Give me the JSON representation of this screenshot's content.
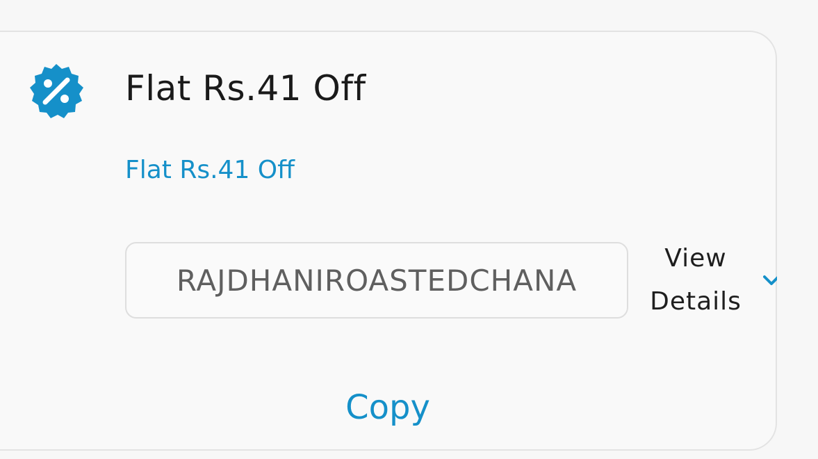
{
  "offer": {
    "title": "Flat Rs.41 Off",
    "subtitle": "Flat Rs.41 Off",
    "coupon_code": "RAJDHANIROASTEDCHANA",
    "view_details_line1": "View",
    "view_details_line2": "Details",
    "copy_label": "Copy",
    "icon": "discount-badge-icon",
    "expand_icon": "chevron-down-icon"
  },
  "colors": {
    "accent": "#1590c9",
    "title_text": "#1a1a1a",
    "code_text": "#5f5f5f",
    "card_border": "#e3e3e3"
  }
}
